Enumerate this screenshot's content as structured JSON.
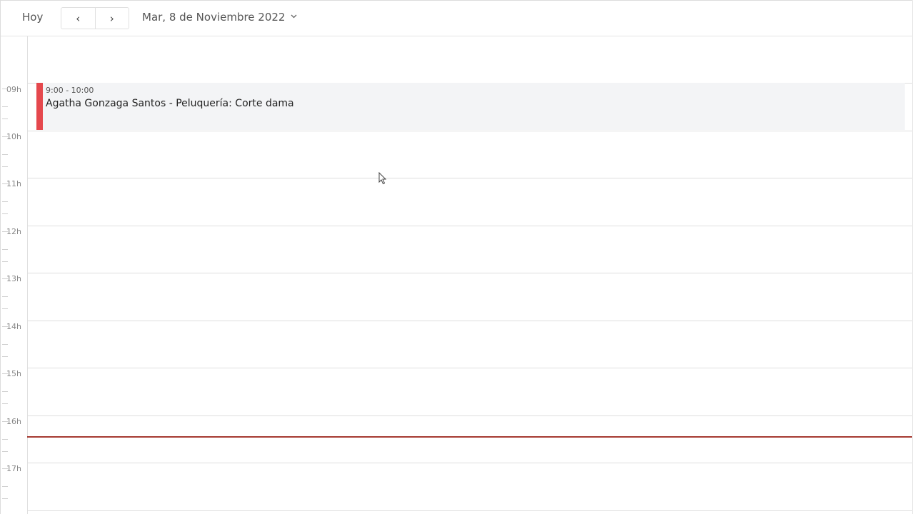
{
  "toolbar": {
    "today_label": "Hoy",
    "prev_label": "‹",
    "next_label": "›",
    "date_label": "Mar, 8 de Noviembre 2022",
    "date_chevron": "⌄"
  },
  "hours": [
    {
      "label": "09h"
    },
    {
      "label": "10h"
    },
    {
      "label": "11h"
    },
    {
      "label": "12h"
    },
    {
      "label": "13h"
    },
    {
      "label": "14h"
    },
    {
      "label": "15h"
    },
    {
      "label": "16h"
    },
    {
      "label": "17h"
    }
  ],
  "events": [
    {
      "time": "9:00 - 10:00",
      "title": "Agatha Gonzaga Santos - Peluquería: Corte dama",
      "color": "#e5484d"
    }
  ],
  "now_line_color": "#a63a32"
}
